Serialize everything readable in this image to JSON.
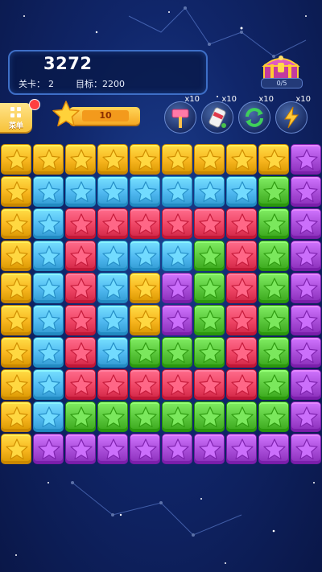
{
  "hud": {
    "score": "3272",
    "level_label": "关卡：",
    "level_value": "2",
    "target_label": "目标：",
    "target_value": "2200",
    "chest_progress": "0/5",
    "menu_label": "菜单",
    "stars_count": "10"
  },
  "powerups": [
    {
      "name": "hammer",
      "count": "x10",
      "icon": "hammer-icon"
    },
    {
      "name": "paint",
      "count": "x10",
      "icon": "paint-bucket-icon"
    },
    {
      "name": "refresh",
      "count": "x10",
      "icon": "refresh-icon"
    },
    {
      "name": "lightning",
      "count": "x10",
      "icon": "lightning-icon"
    }
  ],
  "colors": {
    "yellow": "#f7b51e",
    "blue": "#4fb8f0",
    "red": "#ee4464",
    "green": "#58c53a",
    "purple": "#a84cd8",
    "orange": "#f6a623"
  },
  "board": [
    [
      "Y",
      "Y",
      "Y",
      "Y",
      "Y",
      "Y",
      "Y",
      "Y",
      "Y",
      "P"
    ],
    [
      "Y",
      "B",
      "B",
      "B",
      "B",
      "B",
      "B",
      "B",
      "G",
      "P"
    ],
    [
      "Y",
      "B",
      "R",
      "R",
      "R",
      "R",
      "R",
      "R",
      "G",
      "P"
    ],
    [
      "Y",
      "B",
      "R",
      "B",
      "B",
      "B",
      "G",
      "R",
      "G",
      "P"
    ],
    [
      "Y",
      "B",
      "R",
      "B",
      "Y",
      "P",
      "G",
      "R",
      "G",
      "P"
    ],
    [
      "Y",
      "B",
      "R",
      "B",
      "Y",
      "P",
      "G",
      "R",
      "G",
      "P"
    ],
    [
      "Y",
      "B",
      "R",
      "B",
      "G",
      "G",
      "G",
      "R",
      "G",
      "P"
    ],
    [
      "Y",
      "B",
      "R",
      "R",
      "R",
      "R",
      "R",
      "R",
      "G",
      "P"
    ],
    [
      "Y",
      "B",
      "G",
      "G",
      "G",
      "G",
      "G",
      "G",
      "G",
      "P"
    ],
    [
      "Y",
      "P",
      "P",
      "P",
      "P",
      "P",
      "P",
      "P",
      "P",
      "P"
    ]
  ]
}
